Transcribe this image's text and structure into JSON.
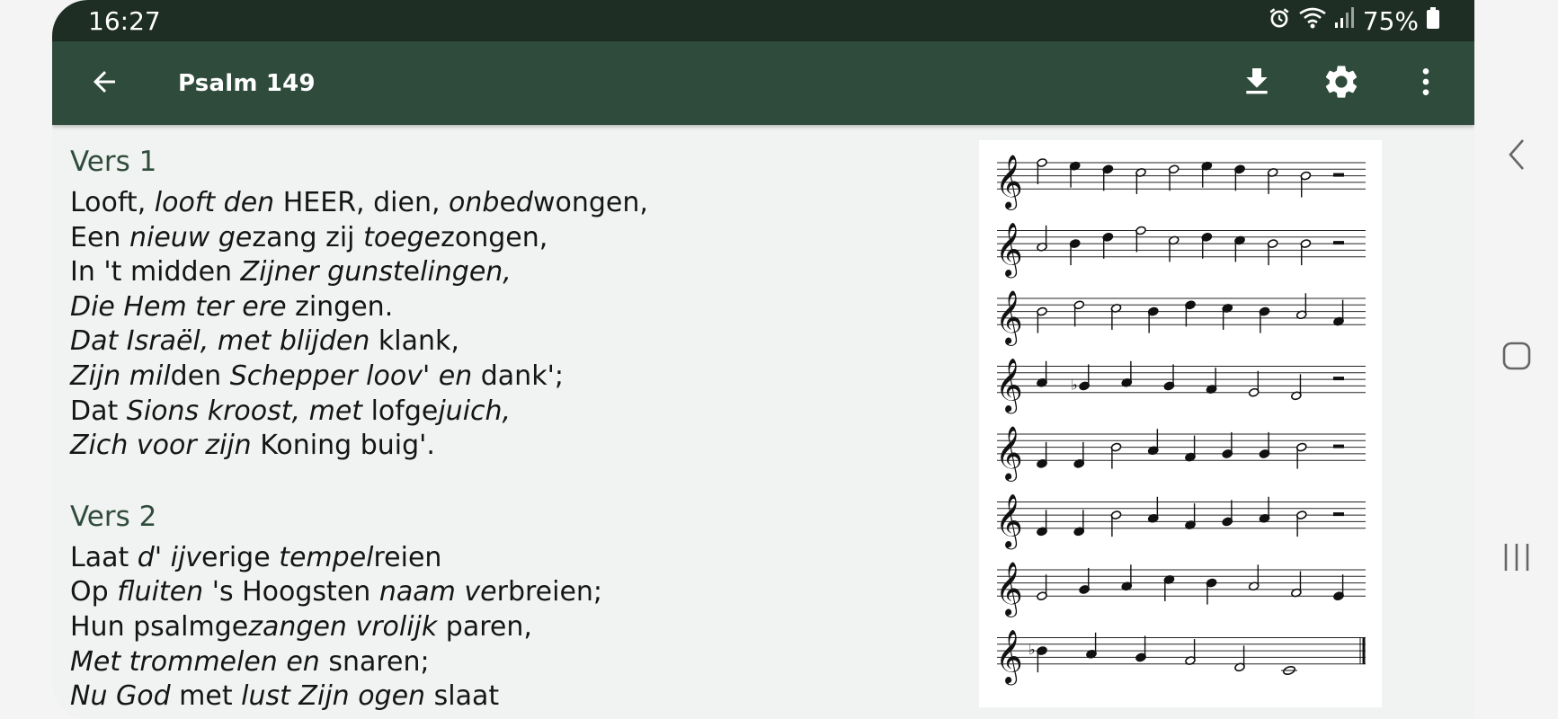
{
  "status_bar": {
    "time": "16:27",
    "battery": "75%",
    "icons": [
      "alarm-icon",
      "wifi-icon",
      "signal-icon",
      "battery-icon"
    ]
  },
  "toolbar": {
    "title": "Psalm 149",
    "back_icon": "arrow-left-icon",
    "actions": [
      "download-icon",
      "settings-icon",
      "more-vert-icon"
    ]
  },
  "colors": {
    "status_bar": "#1e2e24",
    "toolbar": "#2f4b3c",
    "accent_text": "#2f4b3c",
    "background": "#f1f3f2"
  },
  "verses": [
    {
      "title": "Vers 1",
      "lines": [
        [
          [
            "Looft, ",
            false
          ],
          [
            "looft den",
            true
          ],
          [
            " HEER, dien, ",
            false
          ],
          [
            "onb",
            true
          ],
          [
            "e",
            false
          ],
          [
            "d",
            true
          ],
          [
            "wongen,",
            false
          ]
        ],
        [
          [
            "Een ",
            false
          ],
          [
            "nieuw ge",
            true
          ],
          [
            "zang zij ",
            false
          ],
          [
            "toege",
            true
          ],
          [
            "zongen,",
            false
          ]
        ],
        [
          [
            "In 't midden ",
            false
          ],
          [
            "Zijner gunst",
            true
          ],
          [
            "e",
            false
          ],
          [
            "lingen,",
            true
          ]
        ],
        [
          [
            "Die Hem ter ere",
            true
          ],
          [
            " zingen.",
            false
          ]
        ],
        [
          [
            "Dat Israël, met blijden",
            true
          ],
          [
            " klank,",
            false
          ]
        ],
        [
          [
            "Zijn mil",
            true
          ],
          [
            "den ",
            false
          ],
          [
            "Schepper loov' en",
            true
          ],
          [
            " dank';",
            false
          ]
        ],
        [
          [
            "Dat ",
            false
          ],
          [
            "Sions kroost, met",
            true
          ],
          [
            " lofge",
            false
          ],
          [
            "juich,",
            true
          ]
        ],
        [
          [
            "Zich voor zijn",
            true
          ],
          [
            " Koning buig'.",
            false
          ]
        ]
      ]
    },
    {
      "title": "Vers 2",
      "lines": [
        [
          [
            "Laat ",
            false
          ],
          [
            "d' ijv",
            true
          ],
          [
            "erige ",
            false
          ],
          [
            "tempel",
            true
          ],
          [
            "reien",
            false
          ]
        ],
        [
          [
            "Op ",
            false
          ],
          [
            "fluiten",
            true
          ],
          [
            " 's Hoogsten ",
            false
          ],
          [
            "naam ve",
            true
          ],
          [
            "rbreien;",
            false
          ]
        ],
        [
          [
            "Hun psalmge",
            false
          ],
          [
            "zangen vrolijk",
            true
          ],
          [
            " paren,",
            false
          ]
        ],
        [
          [
            "Met trommelen en",
            true
          ],
          [
            " snaren;",
            false
          ]
        ],
        [
          [
            "Nu God",
            true
          ],
          [
            " met ",
            false
          ],
          [
            "lust Zijn ogen",
            true
          ],
          [
            " slaat",
            false
          ]
        ]
      ]
    }
  ],
  "sheet_music": {
    "systems": 8,
    "notes": [
      [
        [
          4,
          "h"
        ],
        [
          3,
          "q"
        ],
        [
          2,
          "q"
        ],
        [
          1,
          "h"
        ],
        [
          2,
          "h"
        ],
        [
          3,
          "q"
        ],
        [
          2,
          "q"
        ],
        [
          1,
          "h"
        ],
        [
          0,
          "h"
        ],
        [
          "r",
          "w"
        ]
      ],
      [
        [
          -1,
          "h"
        ],
        [
          0,
          "q"
        ],
        [
          2,
          "q"
        ],
        [
          4,
          "h"
        ],
        [
          1,
          "h"
        ],
        [
          2,
          "q"
        ],
        [
          1,
          "q"
        ],
        [
          0,
          "h"
        ],
        [
          0,
          "h"
        ],
        [
          "r",
          "w"
        ]
      ],
      [
        [
          0,
          "h"
        ],
        [
          2,
          "h"
        ],
        [
          1,
          "h"
        ],
        [
          0,
          "q"
        ],
        [
          2,
          "q"
        ],
        [
          1,
          "q"
        ],
        [
          0,
          "q"
        ],
        [
          -1,
          "h"
        ],
        [
          -3,
          "q"
        ]
      ],
      [
        [
          -1,
          "q"
        ],
        [
          -2,
          "qb"
        ],
        [
          -1,
          "q"
        ],
        [
          -2,
          "q"
        ],
        [
          -3,
          "q"
        ],
        [
          -4,
          "h"
        ],
        [
          -5,
          "h"
        ],
        [
          "r",
          "w"
        ]
      ],
      [
        [
          -5,
          "q"
        ],
        [
          -5,
          "q"
        ],
        [
          0,
          "h"
        ],
        [
          -1,
          "q"
        ],
        [
          -3,
          "q"
        ],
        [
          -2,
          "q"
        ],
        [
          -2,
          "q"
        ],
        [
          0,
          "h"
        ],
        [
          "r",
          "w"
        ]
      ],
      [
        [
          -5,
          "q"
        ],
        [
          -5,
          "q"
        ],
        [
          0,
          "h"
        ],
        [
          -1,
          "q"
        ],
        [
          -3,
          "q"
        ],
        [
          -2,
          "q"
        ],
        [
          -1,
          "q"
        ],
        [
          0,
          "h"
        ],
        [
          "r",
          "w"
        ]
      ],
      [
        [
          -4,
          "h"
        ],
        [
          -2,
          "q"
        ],
        [
          -1,
          "q"
        ],
        [
          1,
          "q"
        ],
        [
          0,
          "q"
        ],
        [
          -1,
          "h"
        ],
        [
          -3,
          "h"
        ],
        [
          -4,
          "q"
        ]
      ],
      [
        [
          0,
          "qb"
        ],
        [
          -1,
          "q"
        ],
        [
          -2,
          "q"
        ],
        [
          -3,
          "h"
        ],
        [
          -5,
          "h"
        ],
        [
          -6,
          "w"
        ],
        [
          "end",
          "bar"
        ]
      ]
    ]
  },
  "nav_bar": {
    "back": "nav-back-icon",
    "home": "nav-home-icon",
    "recents": "nav-recents-icon"
  }
}
